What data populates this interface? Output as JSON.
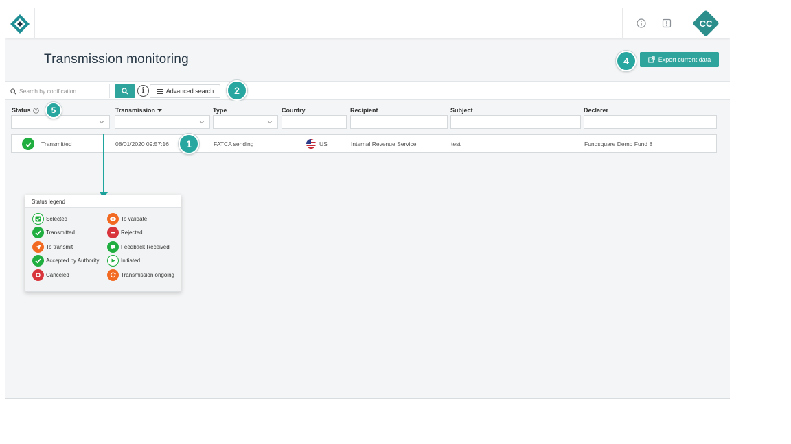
{
  "header": {
    "logo_icon": "diamond-logo-icon",
    "info_icon": "info-circle-icon",
    "alert_icon": "exclamation-box-icon",
    "avatar_initials": "CC"
  },
  "page": {
    "title": "Transmission monitoring",
    "export_label": "Export current data"
  },
  "badges": [
    "1",
    "2",
    "4",
    "5"
  ],
  "search": {
    "placeholder": "Search by codification",
    "advanced_label": "Advanced search",
    "info_glyph": "i"
  },
  "table": {
    "columns": [
      "Status",
      "Transmission",
      "Type",
      "Country",
      "Recipient",
      "Subject",
      "Declarer"
    ],
    "rows": [
      {
        "status": "Transmitted",
        "transmission": "08/01/2020 09:57:16",
        "type": "FATCA sending",
        "country": "US",
        "recipient": "Internal Revenue Service",
        "subject": "test",
        "declarer": "Fundsquare Demo Fund 8"
      }
    ]
  },
  "legend": {
    "title": "Status legend",
    "items": [
      {
        "label": "Selected",
        "icon": "selected-check-icon",
        "color": "#1fae3f"
      },
      {
        "label": "To validate",
        "icon": "eye-icon",
        "color": "#f26a21"
      },
      {
        "label": "Transmitted",
        "icon": "check-icon",
        "color": "#1fae3f"
      },
      {
        "label": "Rejected",
        "icon": "minus-icon",
        "color": "#d8343b"
      },
      {
        "label": "To transmit",
        "icon": "send-icon",
        "color": "#f26a21"
      },
      {
        "label": "Feedback Received",
        "icon": "speech-bubble-icon",
        "color": "#1fae3f"
      },
      {
        "label": "Accepted by Authority",
        "icon": "check-icon",
        "color": "#1fae3f"
      },
      {
        "label": "Initiated",
        "icon": "play-icon",
        "color": "#1fae3f"
      },
      {
        "label": "Canceled",
        "icon": "cancel-icon",
        "color": "#d8343b"
      },
      {
        "label": "Transmission ongoing",
        "icon": "refresh-icon",
        "color": "#f26a21"
      }
    ]
  },
  "colors": {
    "accent": "#2fa49c",
    "success": "#1fae3f",
    "warning": "#f26a21",
    "danger": "#d8343b"
  }
}
